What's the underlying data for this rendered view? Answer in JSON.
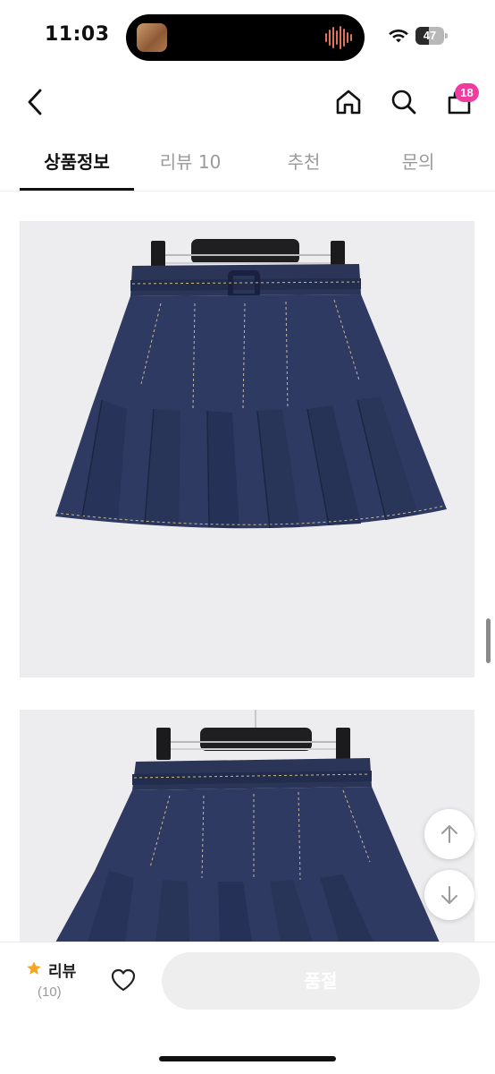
{
  "status_bar": {
    "time": "11:03",
    "battery": "47",
    "battery_level": 0.47,
    "icons": [
      "now-playing-thumbnail",
      "audio-wave-icon",
      "wifi-icon",
      "battery-icon"
    ]
  },
  "nav": {
    "icons": [
      "chevron-left-icon",
      "home-icon",
      "search-icon",
      "shopping-bag-icon"
    ],
    "cart_badge": "18",
    "badge_color": "#f03ba0"
  },
  "tabs": [
    {
      "label": "상품정보",
      "active": true
    },
    {
      "label": "리뷰 10",
      "active": false
    },
    {
      "label": "추천",
      "active": false
    },
    {
      "label": "문의",
      "active": false
    }
  ],
  "images": [
    {
      "subject": "denim-pleated-skirt-photo"
    },
    {
      "subject": "denim-pleated-skirt-photo"
    }
  ],
  "floating_buttons": [
    "arrow-up-icon",
    "arrow-down-icon"
  ],
  "bottom_bar": {
    "review_label": "리뷰",
    "review_count": "(10)",
    "button_label": "품절",
    "star_color": "#f5a623",
    "button_color": "#eeeeee"
  }
}
